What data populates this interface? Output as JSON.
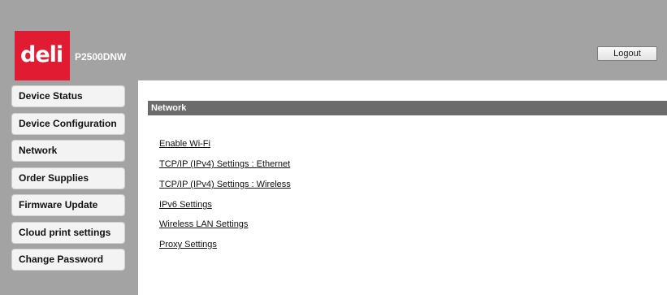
{
  "header": {
    "logo_text": "deli",
    "model": "P2500DNW",
    "logout_label": "Logout",
    "brand_color": "#e01b32"
  },
  "sidebar": {
    "items": [
      {
        "label": "Device Status"
      },
      {
        "label": "Device Configuration"
      },
      {
        "label": "Network"
      },
      {
        "label": "Order Supplies"
      },
      {
        "label": "Firmware Update"
      },
      {
        "label": "Cloud print settings"
      },
      {
        "label": "Change Password"
      }
    ]
  },
  "main": {
    "section_title": "Network",
    "links": [
      {
        "label": "Enable Wi-Fi"
      },
      {
        "label": "TCP/IP (IPv4) Settings : Ethernet"
      },
      {
        "label": "TCP/IP (IPv4) Settings : Wireless"
      },
      {
        "label": "IPv6 Settings"
      },
      {
        "label": "Wireless LAN Settings"
      },
      {
        "label": "Proxy Settings"
      }
    ]
  }
}
